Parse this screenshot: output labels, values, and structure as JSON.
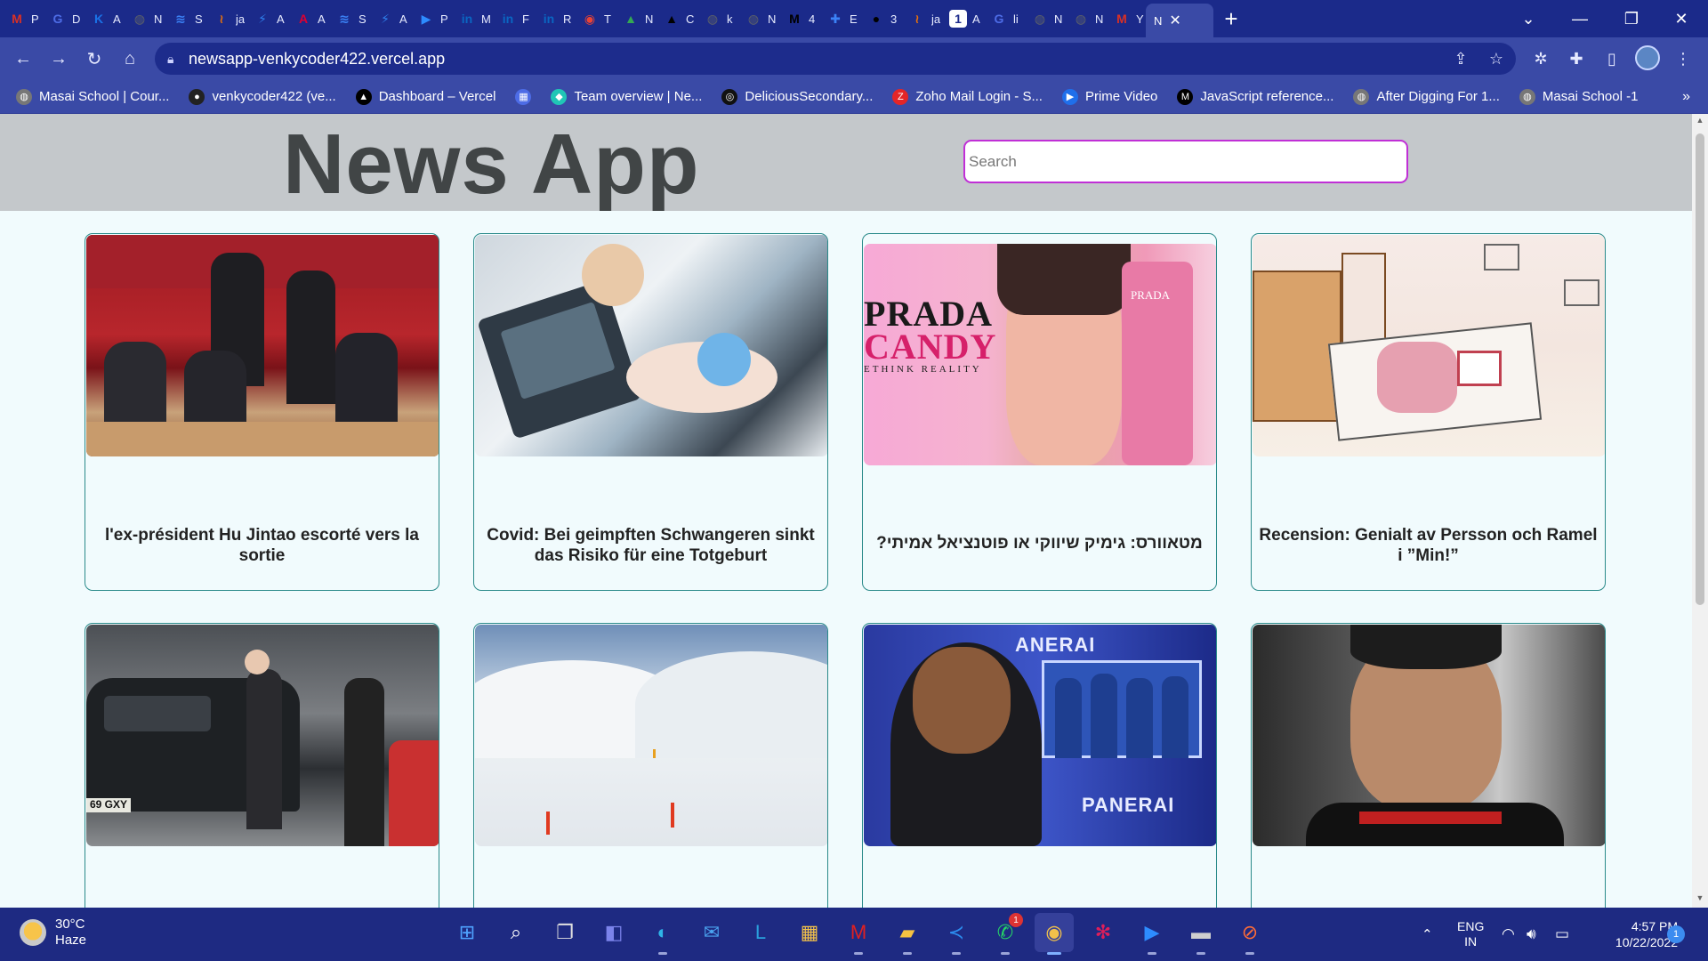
{
  "browser": {
    "tabs": [
      {
        "initial": "P",
        "color": "#d93025",
        "glyph": "M"
      },
      {
        "initial": "D",
        "color": "#4d6ce6",
        "glyph": "G"
      },
      {
        "initial": "A",
        "color": "#1a73e8",
        "glyph": "K"
      },
      {
        "initial": "N",
        "color": "#5f6368",
        "glyph": "◍"
      },
      {
        "initial": "S",
        "color": "#3b82f6",
        "glyph": "≋"
      },
      {
        "initial": "ja",
        "color": "#e8710a",
        "glyph": "≀"
      },
      {
        "initial": "A",
        "color": "#2f80ed",
        "glyph": "⚡"
      },
      {
        "initial": "A",
        "color": "#dd0031",
        "glyph": "A"
      },
      {
        "initial": "S",
        "color": "#3b82f6",
        "glyph": "≋"
      },
      {
        "initial": "A",
        "color": "#2f80ed",
        "glyph": "⚡"
      },
      {
        "initial": "P",
        "color": "#2d8cff",
        "glyph": "▶"
      },
      {
        "initial": "M",
        "color": "#0a66c2",
        "glyph": "in"
      },
      {
        "initial": "F",
        "color": "#0a66c2",
        "glyph": "in"
      },
      {
        "initial": "R",
        "color": "#0a66c2",
        "glyph": "in"
      },
      {
        "initial": "T",
        "color": "#ea4335",
        "glyph": "◉"
      },
      {
        "initial": "N",
        "color": "#34a853",
        "glyph": "▲"
      },
      {
        "initial": "C",
        "color": "#000000",
        "glyph": "▲"
      },
      {
        "initial": "k",
        "color": "#5f6368",
        "glyph": "◍"
      },
      {
        "initial": "N",
        "color": "#5f6368",
        "glyph": "◍"
      },
      {
        "initial": "4",
        "color": "#000000",
        "glyph": "M"
      },
      {
        "initial": "E",
        "color": "#3b82f6",
        "glyph": "✚"
      },
      {
        "initial": "3",
        "color": "#000000",
        "glyph": "●"
      },
      {
        "initial": "ja",
        "color": "#e8710a",
        "glyph": "≀"
      },
      {
        "initial": "A",
        "color": "#ffffff",
        "glyph": "1"
      },
      {
        "initial": "li",
        "color": "#4d6ce6",
        "glyph": "G"
      },
      {
        "initial": "N",
        "color": "#5f6368",
        "glyph": "◍"
      },
      {
        "initial": "N",
        "color": "#5f6368",
        "glyph": "◍"
      },
      {
        "initial": "Y",
        "color": "#d93025",
        "glyph": "M"
      }
    ],
    "active_tab": {
      "initial": "N"
    },
    "url": "newsapp-venkycoder422.vercel.app",
    "bookmarks": [
      {
        "label": "Masai School | Cour...",
        "color": "#777777",
        "glyph": "◍"
      },
      {
        "label": "venkycoder422 (ve...",
        "color": "#222222",
        "glyph": "●"
      },
      {
        "label": "Dashboard – Vercel",
        "color": "#000000",
        "glyph": "▲"
      },
      {
        "label": "",
        "color": "#4d6ce6",
        "glyph": "▦"
      },
      {
        "label": "Team overview | Ne...",
        "color": "#20c6b6",
        "glyph": "◆"
      },
      {
        "label": "DeliciousSecondary...",
        "color": "#111111",
        "glyph": "◎"
      },
      {
        "label": "Zoho Mail Login - S...",
        "color": "#e42527",
        "glyph": "Z"
      },
      {
        "label": "Prime Video",
        "color": "#1f6feb",
        "glyph": "▶"
      },
      {
        "label": "JavaScript reference...",
        "color": "#000000",
        "glyph": "M"
      },
      {
        "label": "After Digging For 1...",
        "color": "#777777",
        "glyph": "◍"
      },
      {
        "label": "Masai School -1",
        "color": "#777777",
        "glyph": "◍"
      }
    ]
  },
  "app": {
    "title": "News App",
    "search_placeholder": "Search"
  },
  "articles": [
    {
      "title": "l'ex-président Hu Jintao escorté vers la sortie",
      "image": "parliament"
    },
    {
      "title": "Covid: Bei geimpften Schwangeren sinkt das Risiko für eine Totgeburt",
      "image": "medical"
    },
    {
      "title": "מטאוורס: גימיק שיווקי או פוטנציאל אמיתי?",
      "image": "prada",
      "image_text": {
        "line1": "PRADA",
        "line2": "CANDY",
        "line3": "ETHINK REALITY",
        "bottle": "PRADA"
      }
    },
    {
      "title": "Recension: Genialt av Persson och Ramel i ”Min!”",
      "image": "sketch"
    },
    {
      "title": "",
      "image": "car",
      "image_text": {
        "plate": "69 GXY"
      }
    },
    {
      "title": "",
      "image": "snow"
    },
    {
      "title": "",
      "image": "cricket",
      "image_text": {
        "brand1": "ANERAI",
        "brand2": "PANERAI"
      }
    },
    {
      "title": "",
      "image": "ronaldo"
    }
  ],
  "taskbar": {
    "weather": {
      "temp": "30°C",
      "condition": "Haze"
    },
    "apps": [
      {
        "name": "start",
        "glyph": "⊞",
        "color": "#4fa3ff"
      },
      {
        "name": "search",
        "glyph": "⌕",
        "color": "#ffffff"
      },
      {
        "name": "task-view",
        "glyph": "❐",
        "color": "#e0e0e0"
      },
      {
        "name": "teams-chat",
        "glyph": "◧",
        "color": "#7b83eb"
      },
      {
        "name": "edge",
        "glyph": "◐",
        "color": "#2fb5e8"
      },
      {
        "name": "mail",
        "glyph": "✉",
        "color": "#4aa3f0"
      },
      {
        "name": "l-app",
        "glyph": "L",
        "color": "#2aa0dc"
      },
      {
        "name": "store",
        "glyph": "▦",
        "color": "#f2c14a"
      },
      {
        "name": "mcafee",
        "glyph": "M",
        "color": "#e02020"
      },
      {
        "name": "file-explorer",
        "glyph": "▰",
        "color": "#f5c242"
      },
      {
        "name": "vscode",
        "glyph": "≺",
        "color": "#2c8ef0"
      },
      {
        "name": "whatsapp",
        "glyph": "✆",
        "color": "#25d366",
        "badge": "1"
      },
      {
        "name": "chrome",
        "glyph": "◉",
        "color": "#f2c14a"
      },
      {
        "name": "slack",
        "glyph": "✻",
        "color": "#e01e5a"
      },
      {
        "name": "zoom",
        "glyph": "▶",
        "color": "#2d8cff"
      },
      {
        "name": "terminal",
        "glyph": "▬",
        "color": "#cfcfcf"
      },
      {
        "name": "postman",
        "glyph": "⊘",
        "color": "#ff6c37"
      }
    ],
    "language": {
      "line1": "ENG",
      "line2": "IN"
    },
    "time": "4:57 PM",
    "date": "10/22/2022",
    "notification_count": "1"
  }
}
